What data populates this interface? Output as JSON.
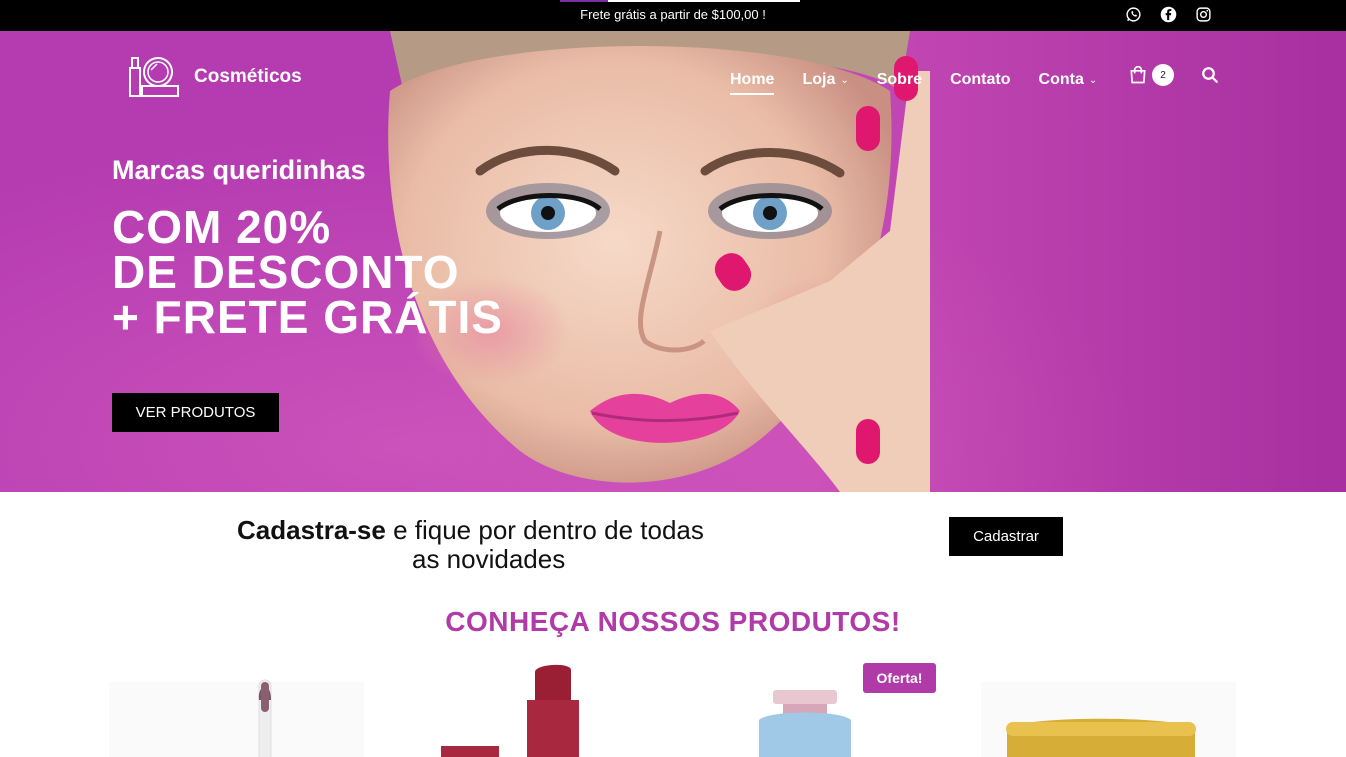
{
  "topbar": {
    "promo": "Frete grátis a partir de $100,00 !",
    "social": [
      "whatsapp-icon",
      "facebook-icon",
      "instagram-icon"
    ]
  },
  "brand": {
    "name": "Cosméticos"
  },
  "nav": {
    "items": [
      {
        "label": "Home",
        "active": true,
        "dropdown": false
      },
      {
        "label": "Loja",
        "active": false,
        "dropdown": true
      },
      {
        "label": "Sobre",
        "active": false,
        "dropdown": false
      },
      {
        "label": "Contato",
        "active": false,
        "dropdown": false
      },
      {
        "label": "Conta",
        "active": false,
        "dropdown": true
      }
    ],
    "cart_count": "2"
  },
  "hero": {
    "kicker": "Marcas queridinhas",
    "headline_1": "COM 20%",
    "headline_2": "DE DESCONTO",
    "headline_3": "+ FRETE GRÁTIS",
    "cta": "VER PRODUTOS"
  },
  "signup": {
    "bold": "Cadastra-se",
    "text_1": " e fique por dentro de todas",
    "text_2": "as novidades",
    "button": "Cadastrar"
  },
  "products": {
    "title": "CONHEÇA NOSSOS PRODUTOS!",
    "sale_badge": "Oferta!"
  },
  "colors": {
    "brand_purple": "#b03aa8",
    "hero_bg": "#b43bb0",
    "black": "#000000",
    "nail_pink": "#e0176f"
  }
}
